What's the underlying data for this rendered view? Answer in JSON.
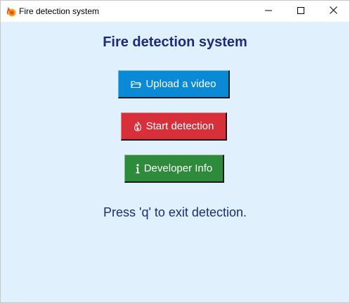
{
  "window": {
    "title": "Fire detection system",
    "icon": "fire-app-icon",
    "controls": [
      "minimize-icon",
      "maximize-icon",
      "close-icon"
    ]
  },
  "main": {
    "heading": "Fire detection system",
    "buttons": [
      {
        "label": "Upload a video",
        "icon": "folder-icon",
        "color": "#0a8ad4"
      },
      {
        "label": "Start detection",
        "icon": "fire-icon",
        "color": "#d7303a"
      },
      {
        "label": "Developer Info",
        "icon": "info-icon",
        "color": "#2e8b3b"
      }
    ],
    "hint": "Press 'q' to exit detection."
  },
  "colors": {
    "background": "#e0f0fc",
    "text": "#1f2a78"
  }
}
